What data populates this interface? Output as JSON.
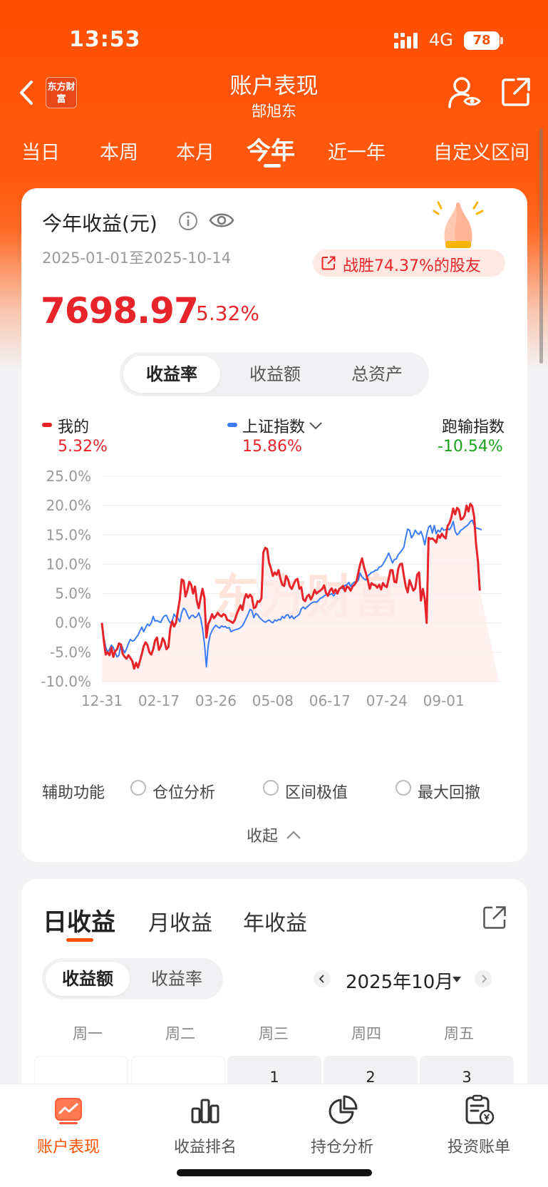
{
  "status_bar": {
    "time": "13:53",
    "network": "4G",
    "battery": "78"
  },
  "header": {
    "logo_text": "东方财富",
    "title": "账户表现",
    "subtitle": "郜旭东"
  },
  "period_tabs": [
    {
      "label": "当日",
      "active": false
    },
    {
      "label": "本周",
      "active": false
    },
    {
      "label": "本月",
      "active": false
    },
    {
      "label": "今年",
      "active": true
    },
    {
      "label": "近一年",
      "active": false
    },
    {
      "label": "自定义区间",
      "active": false
    }
  ],
  "summary": {
    "title": "今年收益(元)",
    "date_range": "2025-01-01至2025-10-14",
    "badge": "战胜74.37%的股友",
    "amount": "7698.97",
    "rate": "5.32%"
  },
  "metric_tabs": [
    {
      "label": "收益率",
      "active": true
    },
    {
      "label": "收益额",
      "active": false
    },
    {
      "label": "总资产",
      "active": false
    }
  ],
  "legend": {
    "mine_label": "我的",
    "mine_value": "5.32%",
    "index_label": "上证指数",
    "index_value": "15.86%",
    "diff_label": "跑输指数",
    "diff_value": "-10.54%"
  },
  "watermark": "东方财富",
  "colors": {
    "brand": "#ff5000",
    "up": "#e8242b",
    "down": "#1aa31a",
    "index": "#3b7cf6"
  },
  "chart_data": {
    "type": "line",
    "x_tick_labels": [
      "12-31",
      "02-17",
      "03-26",
      "05-08",
      "06-17",
      "07-24",
      "09-01"
    ],
    "y_tick_labels": [
      "25.0%",
      "20.0%",
      "15.0%",
      "10.0%",
      "5.0%",
      "0.0%",
      "-5.0%",
      "-10.0%"
    ],
    "ylim": [
      -10,
      25
    ],
    "x": [
      0,
      1,
      2,
      3,
      4,
      5,
      6,
      7,
      8,
      9,
      10,
      11,
      12,
      13,
      14,
      15,
      16,
      17,
      18,
      19,
      20,
      21,
      22,
      23,
      24,
      25,
      26,
      27,
      28,
      29,
      30,
      31,
      32,
      33,
      34,
      35,
      36,
      37,
      38,
      39,
      40,
      41,
      42,
      43,
      44,
      45,
      46,
      47,
      48,
      49,
      50,
      51,
      52,
      53,
      54,
      55,
      56,
      57,
      58,
      59,
      60,
      61,
      62,
      63,
      64,
      65,
      66,
      67,
      68,
      69,
      70,
      71,
      72,
      73,
      74,
      75,
      76,
      77,
      78,
      79,
      80,
      81,
      82,
      83,
      84,
      85,
      86,
      87,
      88,
      89,
      90,
      91,
      92,
      93,
      94,
      95,
      96,
      97,
      98,
      99,
      100,
      101,
      102,
      103,
      104,
      105,
      106,
      107,
      108,
      109,
      110,
      111,
      112,
      113,
      114,
      115,
      116,
      117,
      118,
      119,
      120,
      121,
      122,
      123,
      124,
      125,
      126,
      127,
      128,
      129,
      130,
      131,
      132,
      133,
      134,
      135,
      136,
      137,
      138,
      139,
      140,
      141,
      142,
      143,
      144,
      145,
      146,
      147,
      148,
      149,
      150,
      151,
      152,
      153,
      154,
      155,
      156,
      157,
      158,
      159,
      160,
      161,
      162,
      163,
      164,
      165,
      166,
      167,
      168,
      169,
      170,
      171,
      172,
      173,
      174,
      175,
      176,
      177,
      178,
      179,
      180,
      181,
      182,
      183,
      184,
      185,
      186,
      187,
      188,
      189,
      190,
      191,
      192,
      193,
      194,
      195,
      196,
      197,
      198,
      199,
      200,
      201,
      202,
      203,
      204,
      205,
      206,
      207,
      208,
      209
    ],
    "x_tick_positions": [
      0,
      30,
      60,
      90,
      120,
      150,
      180
    ],
    "series": [
      {
        "name": "我的",
        "color": "#e8242b",
        "values": [
          0,
          -3,
          -5.4,
          -5,
          -5.5,
          -4.2,
          -5.8,
          -4.8,
          -4.5,
          -3.5,
          -3.7,
          -5.3,
          -5.8,
          -6.1,
          -5.5,
          -6,
          -6.5,
          -7.8,
          -6.8,
          -7.6,
          -6.5,
          -5.3,
          -4,
          -3.3,
          -3.8,
          -5,
          -5.4,
          -4.5,
          -3,
          -2.5,
          -4.6,
          -4,
          -2.6,
          -3.2,
          -4.5,
          -4.1,
          -1,
          0.3,
          -0.6,
          0,
          2,
          4,
          7.4,
          7.2,
          4.5,
          5.5,
          7,
          6.5,
          5,
          6.2,
          3.7,
          2.5,
          4.3,
          5.8,
          4.3,
          -2.5,
          -0.2,
          0.5,
          1.5,
          0.8,
          1.2,
          1.7,
          1.3,
          1.1,
          1.5,
          1.3,
          0.5,
          0.4,
          0.2,
          0,
          0.5,
          1.5,
          2.3,
          3,
          2.2,
          4,
          4.9,
          4.3,
          4.8,
          4.4,
          2.5,
          2.7,
          3.7,
          3.6,
          4.2,
          12,
          12.8,
          12.6,
          10.3,
          9.3,
          8,
          8.6,
          8.2,
          9,
          7.5,
          6.5,
          6.3,
          8,
          7.4,
          6.2,
          5.8,
          6.6,
          7.3,
          7.5,
          5.8,
          6.1,
          4,
          3.7,
          4.5,
          4.8,
          4,
          4.6,
          5.6,
          5,
          5.3,
          5.5,
          5.8,
          6.4,
          5.1,
          4.6,
          5.5,
          5.9,
          5.1,
          5.7,
          5,
          5.8,
          6,
          6.3,
          5.4,
          6.2,
          6,
          5.5,
          6.2,
          6.5,
          7,
          8.5,
          10,
          11,
          9.5,
          8.5,
          7.3,
          5.8,
          6.8,
          6.5,
          6.4,
          6,
          6.5,
          5.7,
          6.8,
          6.3,
          6.1,
          7.5,
          9,
          9,
          7,
          6.9,
          9.2,
          10,
          10.1,
          8.1,
          6.2,
          5.2,
          7.3,
          6.4,
          5.5,
          5.9,
          8.2,
          8.6,
          3.8,
          5.8,
          4.1,
          0,
          14.5,
          14.3,
          14.4,
          14.1,
          13.7,
          15,
          14.5,
          15.2,
          14.7,
          14.4,
          16.5,
          17,
          18,
          19.5,
          18.5,
          19.6,
          19.3,
          17.6,
          17.8,
          18.3,
          20,
          19,
          20.3,
          19.9,
          18.1,
          13.5,
          10.5,
          5.5
        ]
      },
      {
        "name": "上证指数",
        "color": "#3b7cf6",
        "values": [
          0,
          -2.5,
          -4.1,
          -5,
          -4.5,
          -3.8,
          -4.2,
          -5.1,
          -5.8,
          -5.5,
          -3.6,
          -4.4,
          -5.1,
          -4.4,
          -3.5,
          -2.8,
          -3.1,
          -3,
          -2.5,
          -2.1,
          -1.4,
          -0.7,
          -1.5,
          -0.8,
          -0.2,
          -0.5,
          0,
          1.1,
          0.3,
          0.4,
          0.2,
          0.1,
          0.8,
          1.2,
          1.3,
          0.5,
          0,
          0.3,
          1.5,
          1,
          0.8,
          0.2,
          1.7,
          2.5,
          2.2,
          1.4,
          0.7,
          1.2,
          1.3,
          0.9,
          1.1,
          1.7,
          0.8,
          -1,
          -3.5,
          -7.5,
          -3.8,
          -2.1,
          -1.3,
          -0.8,
          -0.4,
          -0.7,
          -0.9,
          -0.5,
          -0.7,
          -0.6,
          -0.9,
          -0.8,
          -1.5,
          -1.3,
          -1.2,
          -1.1,
          -1,
          -0.8,
          -0.5,
          0.1,
          0.8,
          1.5,
          2.3,
          2.1,
          0.9,
          1.6,
          1.4,
          0.9,
          0.6,
          0.3,
          0.1,
          0.3,
          0.5,
          0.2,
          0,
          0.5,
          0.3,
          0.6,
          0.5,
          1.1,
          0.8,
          1.3,
          1.4,
          0.8,
          1.2,
          0.7,
          1,
          1.2,
          1.5,
          2.4,
          2.7,
          2.4,
          2.7,
          3,
          3.3,
          3.5,
          3.6,
          3.5,
          3.8,
          4.2,
          4.3,
          4.6,
          4.8,
          4.9,
          4.8,
          5,
          4.6,
          5,
          5.4,
          5.7,
          6,
          5.8,
          6.4,
          6.5,
          6.9,
          6.2,
          6.7,
          7,
          6.9,
          7.3,
          8.5,
          7.8,
          7.5,
          7.3,
          8,
          8.3,
          8.6,
          8.7,
          9,
          9,
          9.5,
          9.6,
          10,
          10.6,
          11.2,
          11.9,
          11.1,
          10.2,
          10.8,
          10.9,
          11.6,
          12,
          12.4,
          12.9,
          14.6,
          16,
          15.8,
          14.5,
          15,
          15.8,
          15.3,
          15.1,
          15.6,
          14.7,
          13.3,
          15,
          16.3,
          16.6,
          15.3,
          16.6,
          15.2,
          15.8,
          15.5,
          16.2,
          15.8,
          15.9,
          16.1,
          15.9,
          16.4,
          17.3,
          15.6,
          15,
          15.3,
          15.8,
          16,
          16.3,
          16.5,
          16.8,
          17.3,
          17.5,
          16.6,
          16.2,
          16.1,
          16,
          15.86
        ]
      }
    ]
  },
  "aux": {
    "label": "辅助功能",
    "options": [
      "仓位分析",
      "区间极值",
      "最大回撤"
    ]
  },
  "collapse_label": "收起",
  "daily": {
    "tabs": [
      {
        "label": "日收益",
        "active": true
      },
      {
        "label": "月收益",
        "active": false
      },
      {
        "label": "年收益",
        "active": false
      }
    ],
    "seg": [
      {
        "label": "收益额",
        "active": true
      },
      {
        "label": "收益率",
        "active": false
      }
    ],
    "month": "2025年10月",
    "weekdays": [
      "周一",
      "周二",
      "周三",
      "周四",
      "周五"
    ],
    "days": [
      "",
      "",
      "1",
      "2",
      "3"
    ]
  },
  "bottom_nav": [
    {
      "label": "账户表现",
      "active": true
    },
    {
      "label": "收益排名",
      "active": false
    },
    {
      "label": "持仓分析",
      "active": false
    },
    {
      "label": "投资账单",
      "active": false
    }
  ]
}
